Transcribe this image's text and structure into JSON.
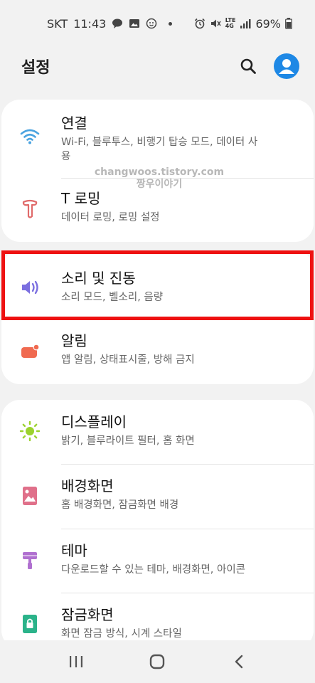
{
  "status_bar": {
    "carrier": "SKT",
    "time": "11:43",
    "battery": "69%",
    "network": "LTE",
    "network_sub": "4G"
  },
  "header": {
    "title": "설정"
  },
  "watermark": {
    "line1": "changwoos.tistory.com",
    "line2": "짱우이야기"
  },
  "items": [
    {
      "name": "연결",
      "sub": "Wi-Fi, 블루투스, 비행기 탑승 모드, 데이터 사용",
      "icon": "wifi-icon"
    },
    {
      "name": "T 로밍",
      "sub": "데이터 로밍, 로밍 설정",
      "icon": "t-roaming-icon"
    },
    {
      "name": "소리 및 진동",
      "sub": "소리 모드, 벨소리, 음량",
      "icon": "speaker-icon"
    },
    {
      "name": "알림",
      "sub": "앱 알림, 상태표시줄, 방해 금지",
      "icon": "notification-icon"
    },
    {
      "name": "디스플레이",
      "sub": "밝기, 블루라이트 필터, 홈 화면",
      "icon": "brightness-icon"
    },
    {
      "name": "배경화면",
      "sub": "홈 배경화면, 잠금화면 배경",
      "icon": "wallpaper-icon"
    },
    {
      "name": "테마",
      "sub": "다운로드할 수 있는 테마, 배경화면, 아이콘",
      "icon": "theme-brush-icon"
    },
    {
      "name": "잠금화면",
      "sub": "화면 잠금 방식, 시계 스타일",
      "icon": "lock-icon"
    }
  ],
  "colors": {
    "wifi": "#4aa3e0",
    "t_roaming": "#e06a6a",
    "speaker": "#7b6fe0",
    "notification": "#f06a50",
    "display": "#9bd22e",
    "wallpaper": "#e0708a",
    "theme": "#b070d0",
    "lock": "#2bb38a",
    "highlight": "#ee1111",
    "avatar": "#1e88e5"
  }
}
